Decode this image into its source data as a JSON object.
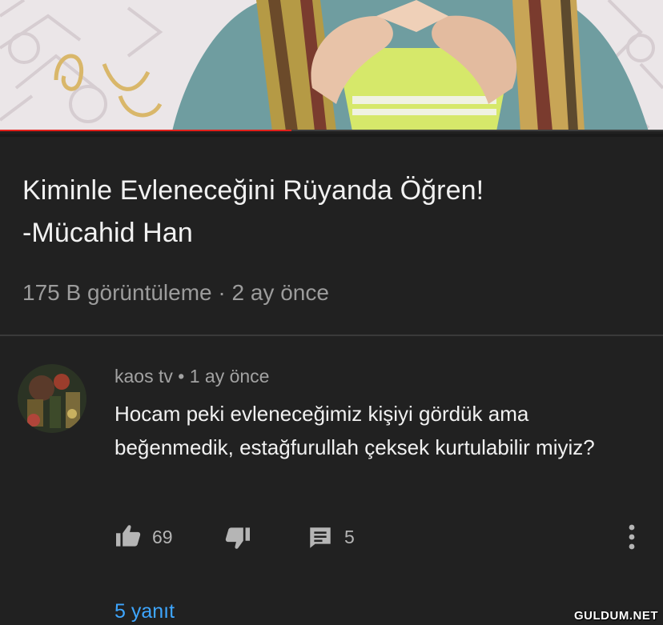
{
  "video": {
    "title_line1": "Kiminle Evleneceğini Rüyanda Öğren!",
    "title_line2": "-Mücahid Han",
    "views": "175 B görüntüleme",
    "separator": " · ",
    "age": "2 ay önce",
    "progress": 0.44
  },
  "comment": {
    "author": "kaos tv",
    "separator": " • ",
    "time": "1 ay önce",
    "text": "Hocam peki evleneceğimiz kişiyi gördük ama beğenmedik, estağfurullah çeksek kurtulabilir miyiz?",
    "likes": "69",
    "reply_count": "5",
    "replies_link": "5 yanıt"
  },
  "icons": [
    "thumbs-up-icon",
    "thumbs-down-icon",
    "reply-icon",
    "more-vert-icon"
  ],
  "watermark": "GULDUM.NET",
  "colors": {
    "background": "#212121",
    "progress": "#e0201b",
    "link": "#3ea6ff",
    "secondary_text": "#9c9c9c"
  }
}
